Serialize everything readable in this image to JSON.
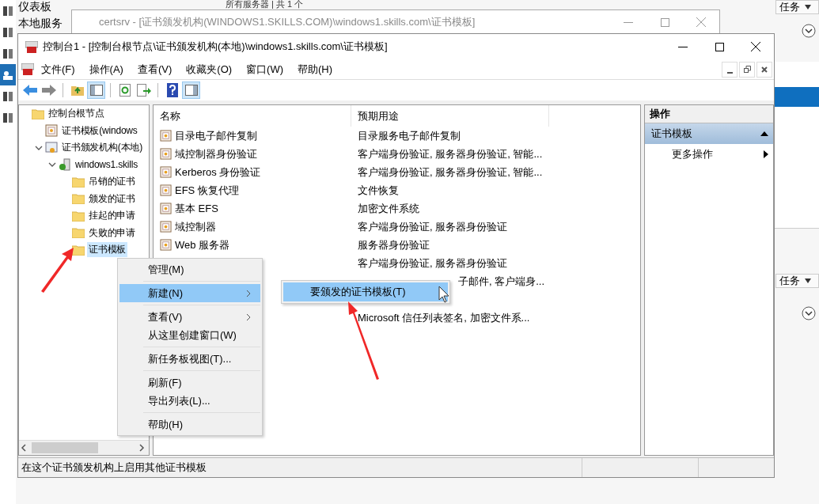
{
  "background": {
    "sidebar_items": [
      {
        "label": "仪表板",
        "selected": false
      },
      {
        "label": "本地服务",
        "selected": false
      }
    ],
    "header": "所有服务器 | 共 1 个",
    "task_buttons": [
      "任务",
      "任务"
    ]
  },
  "back_window": {
    "title": "certsrv - [证书颁发机构(WINDOWS1.SKILLS.COM)\\windows1.skills.com\\证书模板]"
  },
  "window": {
    "title": "控制台1 - [控制台根节点\\证书颁发机构(本地)\\windows1.skills.com\\证书模板]",
    "menu": [
      "文件(F)",
      "操作(A)",
      "查看(V)",
      "收藏夹(O)",
      "窗口(W)",
      "帮助(H)"
    ]
  },
  "tree": [
    {
      "label": "控制台根节点",
      "kind": "folder",
      "selected": false,
      "children": [
        {
          "label": "证书模板(windows",
          "kind": "template",
          "selected": false
        },
        {
          "label": "证书颁发机构(本地)",
          "kind": "ca",
          "selected": false,
          "expanded": true,
          "children": [
            {
              "label": "windows1.skills",
              "kind": "server",
              "selected": false,
              "expanded": true,
              "children": [
                {
                  "label": "吊销的证书",
                  "kind": "folder",
                  "selected": false
                },
                {
                  "label": "颁发的证书",
                  "kind": "folder",
                  "selected": false
                },
                {
                  "label": "挂起的申请",
                  "kind": "folder",
                  "selected": false
                },
                {
                  "label": "失败的申请",
                  "kind": "folder",
                  "selected": false
                },
                {
                  "label": "证书模板",
                  "kind": "folder",
                  "selected": true
                }
              ]
            }
          ]
        }
      ]
    }
  ],
  "list": {
    "columns": [
      "名称",
      "预期用途"
    ],
    "rows": [
      {
        "name": "目录电子邮件复制",
        "purpose": "目录服务电子邮件复制"
      },
      {
        "name": "域控制器身份验证",
        "purpose": "客户端身份验证, 服务器身份验证, 智能..."
      },
      {
        "name": "Kerberos 身份验证",
        "purpose": "客户端身份验证, 服务器身份验证, 智能..."
      },
      {
        "name": "EFS 恢复代理",
        "purpose": "文件恢复"
      },
      {
        "name": "基本 EFS",
        "purpose": "加密文件系统"
      },
      {
        "name": "域控制器",
        "purpose": "客户端身份验证, 服务器身份验证"
      },
      {
        "name": "Web 服务器",
        "purpose": "服务器身份验证"
      },
      {
        "purpose": "客户端身份验证, 服务器身份验证"
      },
      {
        "purpose": "子邮件, 客户端身...",
        "kind": "partial"
      },
      {
        "kind": "covered"
      },
      {
        "purpose": "Microsoft 信任列表签名, 加密文件系..."
      }
    ]
  },
  "actions": {
    "title": "操作",
    "group": {
      "label": "证书模板",
      "expanded": true
    },
    "items": [
      "更多操作"
    ]
  },
  "context_menu": {
    "items": [
      {
        "kind": "item",
        "label": "管理(M)",
        "submenu": false,
        "selected": false
      },
      {
        "kind": "separator"
      },
      {
        "kind": "item",
        "label": "新建(N)",
        "submenu": true,
        "selected": true
      },
      {
        "kind": "separator"
      },
      {
        "kind": "item",
        "label": "查看(V)",
        "submenu": true,
        "selected": false
      },
      {
        "kind": "item",
        "label": "从这里创建窗口(W)",
        "submenu": false,
        "selected": false
      },
      {
        "kind": "separator"
      },
      {
        "kind": "item",
        "label": "新任务板视图(T)...",
        "submenu": false,
        "selected": false
      },
      {
        "kind": "separator"
      },
      {
        "kind": "item",
        "label": "刷新(F)",
        "submenu": false,
        "selected": false
      },
      {
        "kind": "item",
        "label": "导出列表(L)...",
        "submenu": false,
        "selected": false
      },
      {
        "kind": "separator"
      },
      {
        "kind": "item",
        "label": "帮助(H)",
        "submenu": false,
        "selected": false
      }
    ]
  },
  "submenu": {
    "items": [
      {
        "label": "要颁发的证书模板(T)",
        "selected": true
      }
    ]
  },
  "status_bar": [
    "在这个证书颁发机构上启用其他证书模板"
  ]
}
